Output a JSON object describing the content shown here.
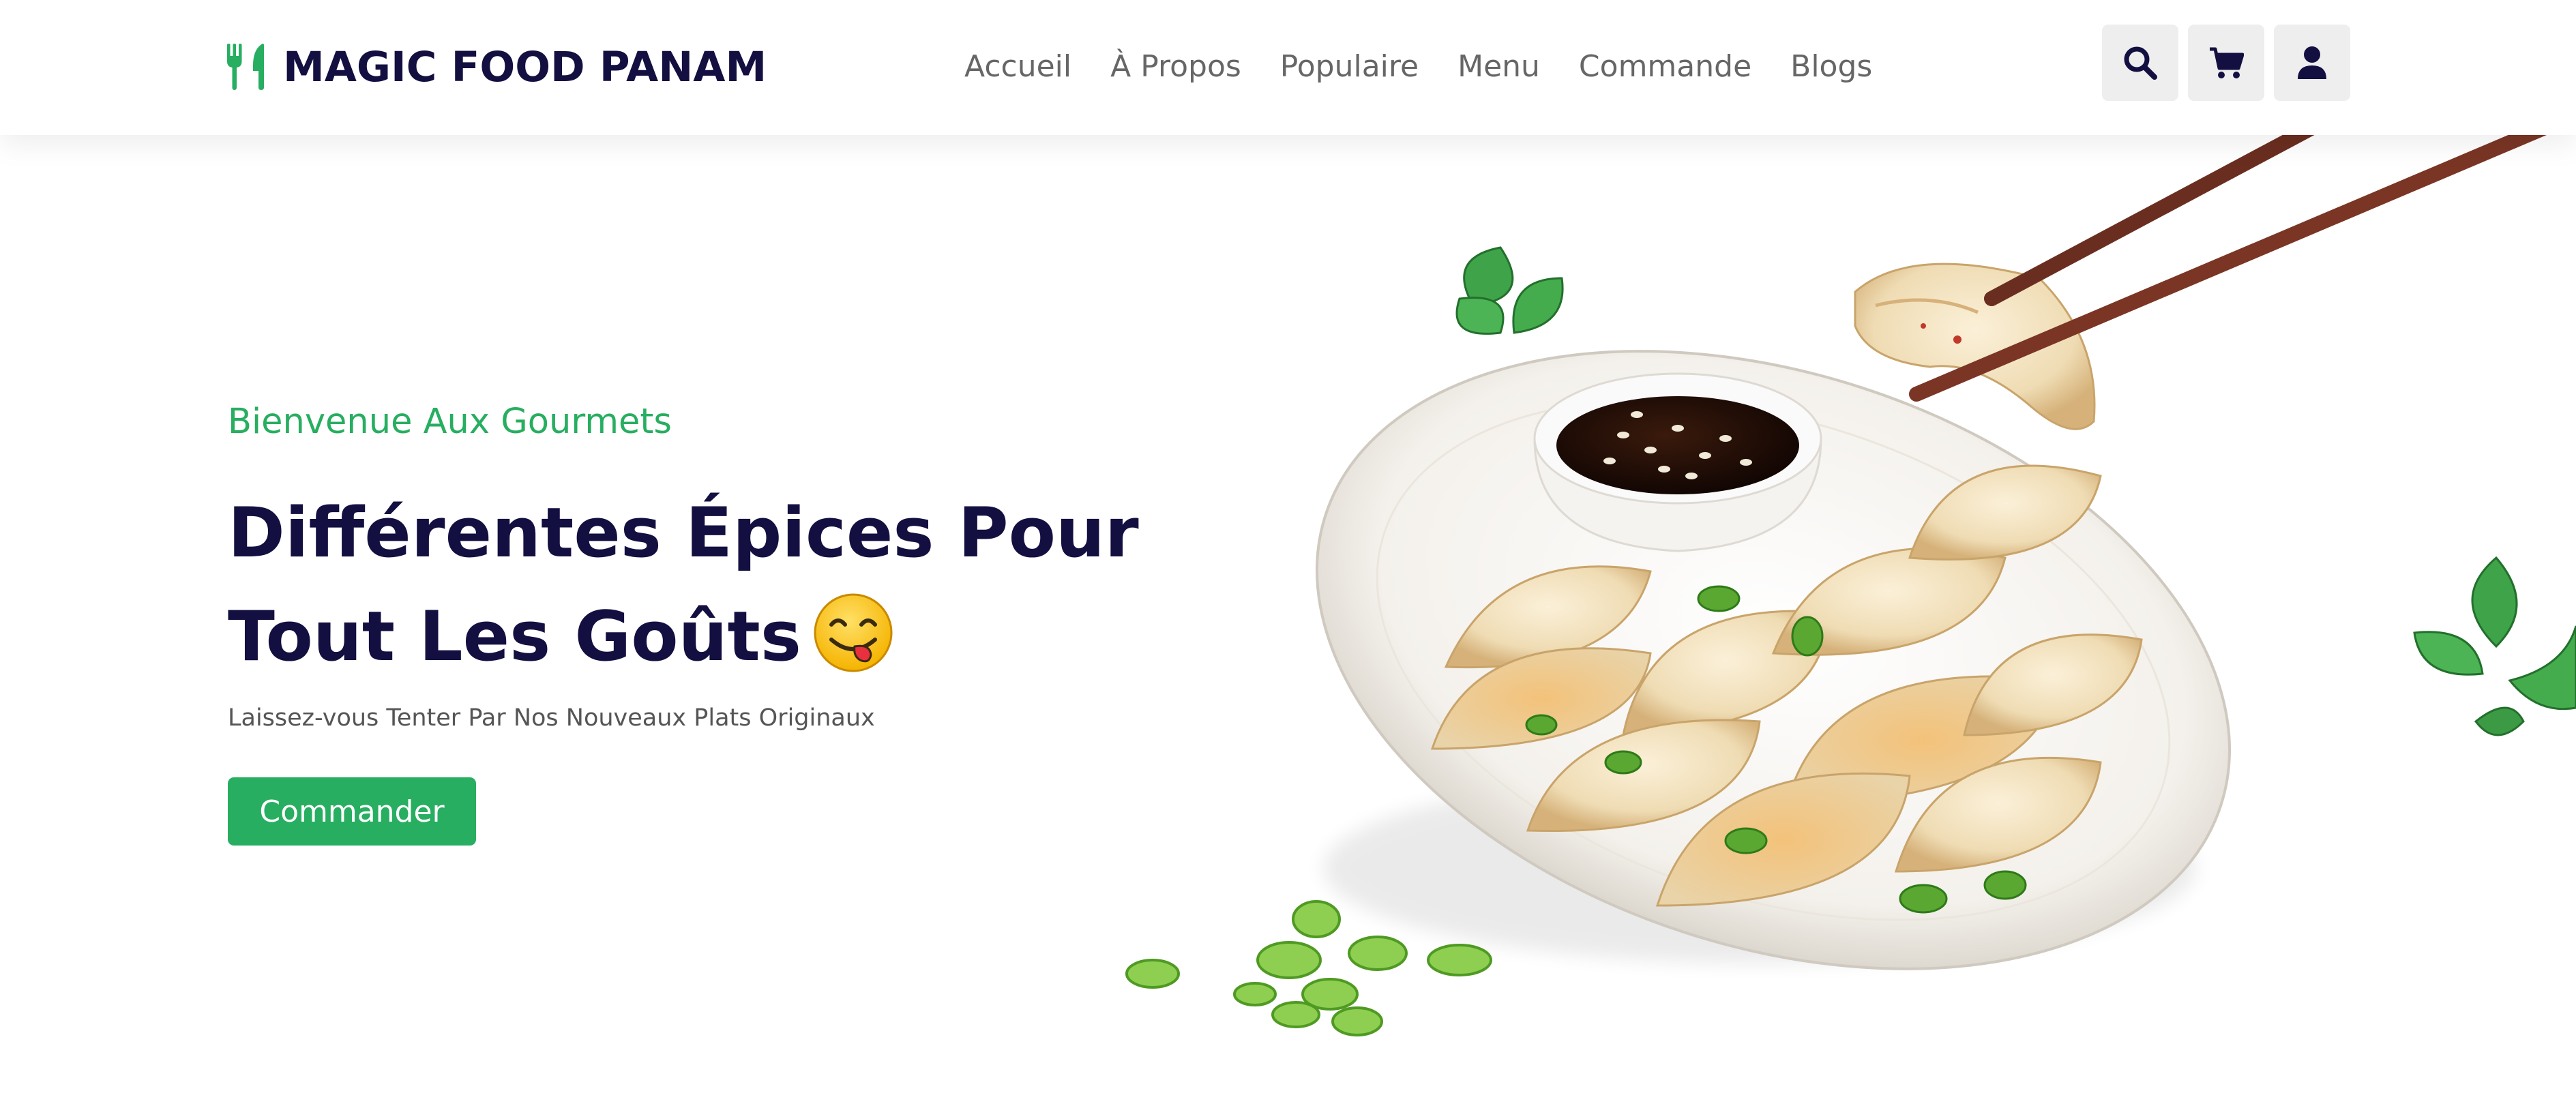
{
  "brand": {
    "name": "MAGIC FOOD PANAM",
    "accent": "#27ae60",
    "dark": "#130f40",
    "icon": "utensils-icon"
  },
  "nav": [
    {
      "label": "Accueil"
    },
    {
      "label": "À Propos"
    },
    {
      "label": "Populaire"
    },
    {
      "label": "Menu"
    },
    {
      "label": "Commande"
    },
    {
      "label": "Blogs"
    }
  ],
  "header_icons": [
    "search-icon",
    "cart-icon",
    "user-icon"
  ],
  "hero": {
    "subtitle": "Bienvenue Aux Gourmets",
    "title": "Différentes Épices Pour Tout Les Goûts",
    "emoji": "face-savoring-food-emoji",
    "description": "Laissez-vous Tenter Par Nos Nouveaux Plats Originaux",
    "button": "Commander",
    "image": "plate of pan-fried dumplings with soy sauce bowl, chopsticks, mint leaves and spring onions"
  }
}
